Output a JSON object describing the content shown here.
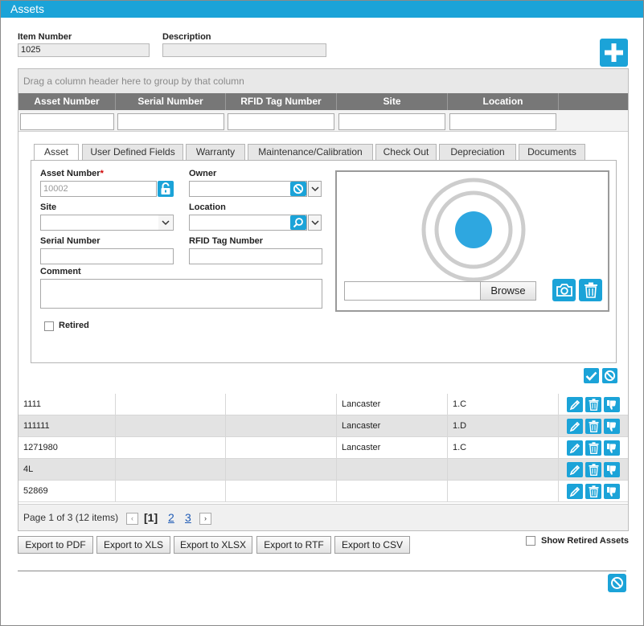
{
  "window": {
    "title": "Assets"
  },
  "header": {
    "item_number_label": "Item Number",
    "item_number_value": "1025",
    "description_label": "Description",
    "description_value": ""
  },
  "grid": {
    "group_panel_text": "Drag a column header here to group by that column",
    "columns": [
      "Asset Number",
      "Serial Number",
      "RFID Tag Number",
      "Site",
      "Location"
    ]
  },
  "form": {
    "tabs": [
      "Asset",
      "User Defined Fields",
      "Warranty",
      "Maintenance/Calibration",
      "Check Out",
      "Depreciation",
      "Documents"
    ],
    "active_tab": "Asset",
    "asset_number_label": "Asset Number",
    "required_mark": "*",
    "asset_number_placeholder": "10002",
    "owner_label": "Owner",
    "site_label": "Site",
    "location_label": "Location",
    "serial_number_label": "Serial Number",
    "rfid_label": "RFID Tag Number",
    "comment_label": "Comment",
    "retired_label": "Retired",
    "browse_label": "Browse"
  },
  "rows": [
    {
      "asset": "1111",
      "serial": "",
      "rfid": "",
      "site": "Lancaster",
      "location": "1.C"
    },
    {
      "asset": "111111",
      "serial": "",
      "rfid": "",
      "site": "Lancaster",
      "location": "1.D"
    },
    {
      "asset": "1271980",
      "serial": "",
      "rfid": "",
      "site": "Lancaster",
      "location": "1.C"
    },
    {
      "asset": "4L",
      "serial": "",
      "rfid": "",
      "site": "",
      "location": ""
    },
    {
      "asset": "52869",
      "serial": "",
      "rfid": "",
      "site": "",
      "location": ""
    }
  ],
  "pager": {
    "summary": "Page 1 of 3 (12 items)",
    "current": "[1]",
    "pages": [
      "2",
      "3"
    ]
  },
  "exports": [
    "Export to PDF",
    "Export to XLS",
    "Export to XLSX",
    "Export to RTF",
    "Export to CSV"
  ],
  "show_retired_label": "Show Retired Assets",
  "colors": {
    "accent": "#1ba3d8",
    "header": "#777777",
    "alt_row": "#e3e3e3"
  }
}
